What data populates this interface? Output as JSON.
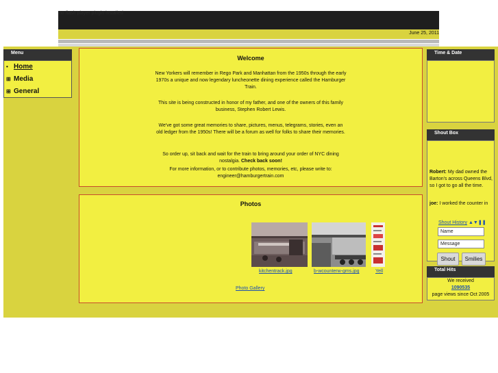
{
  "header": {
    "flash_message": "no flash player plugin installed",
    "date": "June 25, 2011"
  },
  "menu": {
    "title": "Menu",
    "items": [
      {
        "label": "Home",
        "glyph": "•"
      },
      {
        "label": "Media",
        "glyph": "⊞"
      },
      {
        "label": "General",
        "glyph": "⊞"
      }
    ]
  },
  "welcome": {
    "title": "Welcome",
    "p1": "New Yorkers will remember in Rego Park and Manhattan from the 1950s through the early 1970s a unique and now legendary luncheonette dining experience called the Hamburger Train.",
    "p2": "This site is being constructed in honor of my father, and one of the owners of this family business, Stephen Robert Lewis.",
    "p3": "We've got some great memories to share, pictures, menus, telegrams, stories, even an old ledger from the 1950s! There will be a forum as well for folks to share their memories.",
    "p4_lead": "So order up, sit back and wait for the train to bring around your order of NYC dining nostalgia.",
    "p4_bold": "Check back soon!",
    "p5": "For more information, or to contribute photos, memories, etc, please write to: engineer@hamburgertrain.com"
  },
  "photos": {
    "title": "Photos",
    "items": [
      {
        "caption": "kitchentrack.jpg"
      },
      {
        "caption": "b-wcounterw-gms.jpg"
      },
      {
        "caption": "Yell"
      }
    ],
    "gallery_link": "Photo Gallery"
  },
  "sidebar": {
    "time_title": "Time & Date",
    "shout_title": "Shout Box",
    "shout1_name": "Robert:",
    "shout1_text": "My dad owned the Barton's across Queens Blvd, so I got to go all the time.",
    "shout2_name": "joe:",
    "shout2_text": "I worked the counter in the",
    "shout_history": "Shout History",
    "name_placeholder": "Name",
    "message_placeholder": "Message",
    "shout_button": "Shout",
    "smilies_button": "Smilies",
    "hits_title": "Total Hits",
    "hits_line1": "We received",
    "hits_count": "1090535",
    "hits_line3": "page views since Oct 2005"
  },
  "colors": {
    "page_yellow": "#d9d33f",
    "panel_yellow": "#f2ef41",
    "panel_border": "#c84a2a",
    "header_dark": "#333333",
    "link": "#1a4fb0"
  }
}
